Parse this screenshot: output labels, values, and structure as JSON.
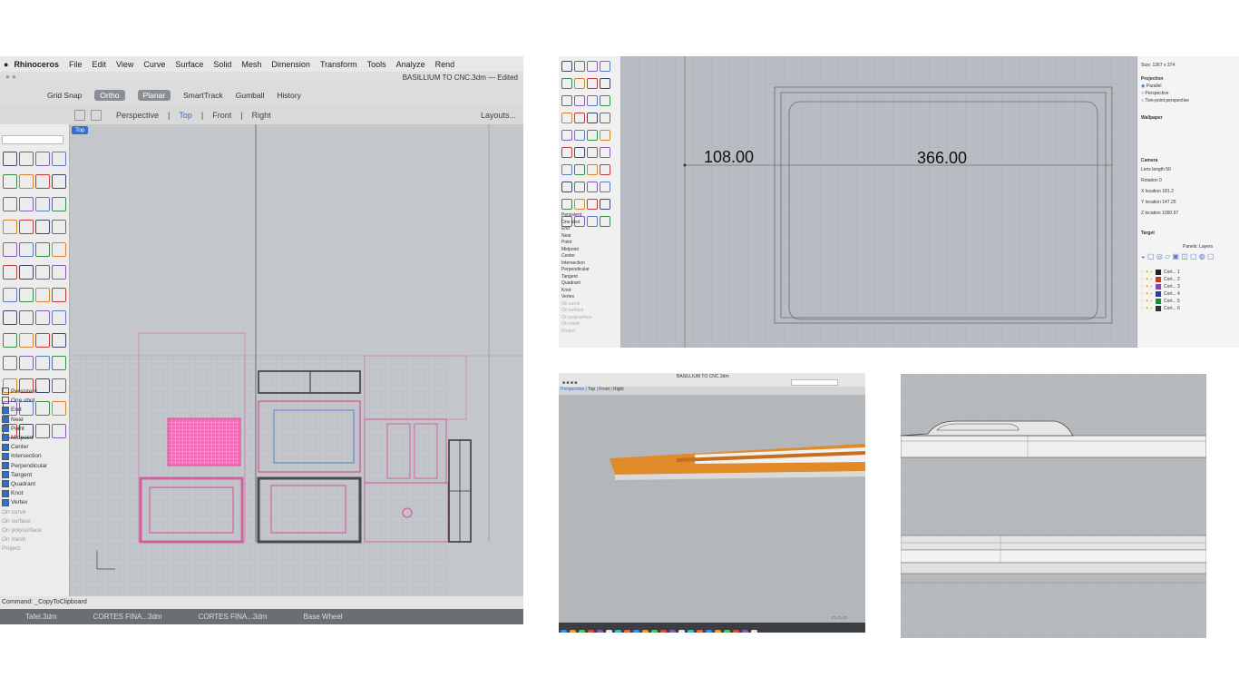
{
  "rhino_window": {
    "menu": [
      "Rhinoceros",
      "File",
      "Edit",
      "View",
      "Curve",
      "Surface",
      "Solid",
      "Mesh",
      "Dimension",
      "Transform",
      "Tools",
      "Analyze",
      "Rend"
    ],
    "file_title": "BASILLIUM TO CNC.3dm — Edited",
    "toolbar": [
      "Grid Snap",
      "Ortho",
      "Planar",
      "SmartTrack",
      "Gumball",
      "History"
    ],
    "viewport_tabs": [
      "Perspective",
      "Top",
      "Front",
      "Right"
    ],
    "active_tab": "Top",
    "layouts_label": "Layouts...",
    "viewport_label": "Top",
    "osnap_panel": {
      "items": [
        "Persistent",
        "One shot",
        "End",
        "Near",
        "Point",
        "Midpoint",
        "Center",
        "Intersection",
        "Perpendicular",
        "Tangent",
        "Quadrant",
        "Knot",
        "Vertex"
      ],
      "disabled_items": [
        "On curve",
        "On surface",
        "On polysurface",
        "On mesh",
        "Project"
      ]
    },
    "command": "Command: _CopyToClipboard",
    "taskbar": [
      "Tafel.3dm",
      "CORTES FINA...3dm",
      "CORTES FINA...3dm",
      "Base Wheel"
    ]
  },
  "dimension_view": {
    "dimensions": [
      "108.00",
      "366.00"
    ],
    "snaps": [
      "Persistent",
      "One shot",
      "End",
      "Near",
      "Point",
      "Midpoint",
      "Center",
      "Intersection",
      "Perpendicular",
      "Tangent",
      "Quadrant",
      "Knot",
      "Vertex"
    ],
    "snaps_disabled": [
      "On curve",
      "On surface",
      "On polysurface",
      "On mesh",
      "Project"
    ],
    "properties": {
      "size": "Size: 1367 x 374",
      "projection_label": "Projection",
      "projection_options": [
        "Parallel",
        "Perspective",
        "Two-point perspective"
      ],
      "wallpaper_label": "Wallpaper",
      "camera_label": "Camera",
      "lens_length": "Lens length 50",
      "rotation": "Rotation 0",
      "x_location": "X location 181.2",
      "y_location": "Y location 147.25",
      "z_location": "Z location 1000.97",
      "target_label": "Target",
      "panels_title": "Panels: Layers",
      "layer_names": [
        "Cort... 1",
        "Cort... 2",
        "Cort... 3",
        "Cort... 4",
        "Cort... 5",
        "Cort... 6"
      ],
      "layer_colors": [
        "#222222",
        "#c0392b",
        "#8e44ad",
        "#2c3e9e",
        "#1e8a3a",
        "#333333"
      ]
    }
  },
  "perspective_view": {
    "file_title": "BASILLIUM TO CNC.3dm",
    "viewport_tabs": [
      "Perspective",
      "Top",
      "Front",
      "Right"
    ]
  }
}
